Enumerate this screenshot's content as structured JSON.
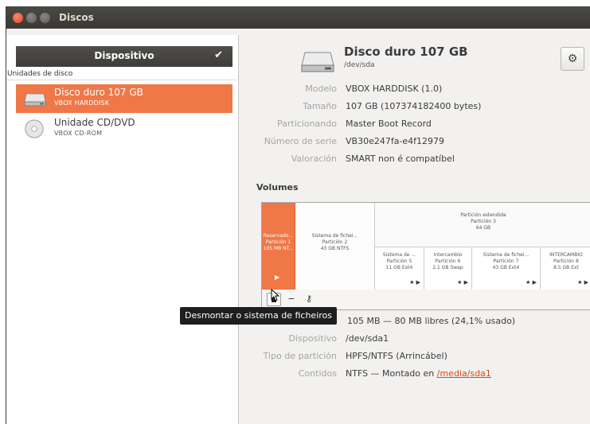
{
  "window": {
    "title": "Discos"
  },
  "sidebar": {
    "header": "Dispositivo",
    "group_label": "Unidades de disco",
    "devices": [
      {
        "name": "Disco duro 107 GB",
        "sub": "VBOX HARDDISK",
        "icon": "hard-disk-icon",
        "selected": true
      },
      {
        "name": "Unidade CD/DVD",
        "sub": "VBOX CD-ROM",
        "icon": "optical-disc-icon",
        "selected": false
      }
    ]
  },
  "disk": {
    "title": "Disco duro 107 GB",
    "path": "/dev/sda",
    "properties": [
      {
        "label": "Modelo",
        "value": "VBOX HARDDISK (1.0)"
      },
      {
        "label": "Tamaño",
        "value": "107 GB (107374182400 bytes)"
      },
      {
        "label": "Particionando",
        "value": "Master Boot Record"
      },
      {
        "label": "Número de serie",
        "value": "VB30e247fa-e4f12979"
      },
      {
        "label": "Valoración",
        "value": "SMART non é compatíbel"
      }
    ]
  },
  "volumes": {
    "heading": "Volumes",
    "partitions": [
      {
        "line1": "Reservado...",
        "line2": "Partición 1",
        "line3": "105 MB NT..."
      },
      {
        "line1": "Sistema de fichei...",
        "line2": "Partición 2",
        "line3": "43 GB NTFS"
      }
    ],
    "extended": {
      "line1": "Partición estendida",
      "line2": "Partición 3",
      "line3": "64 GB"
    },
    "logical": [
      {
        "line1": "Sistema de ...",
        "line2": "Partición 5",
        "line3": "11 GB Ext4"
      },
      {
        "line1": "Intercambio",
        "line2": "Partición 6",
        "line3": "2.1 GB Swap"
      },
      {
        "line1": "Sistema de fichei...",
        "line2": "Partición 7",
        "line3": "43 GB Ext4"
      },
      {
        "line1": "INTERCAMBIO",
        "line2": "Partición 8",
        "line3": "8.5 GB Ext"
      }
    ],
    "toolbar": {
      "minus": "−",
      "key": "⚷"
    },
    "tooltip": "Desmontar o sistema de ficheiros",
    "size_text": "105 MB — 80 MB libres (24,1% usado)",
    "device_label": "Dispositivo",
    "device_value": "/dev/sda1",
    "type_label": "Tipo de partición",
    "type_value": "HPFS/NTFS (Arrincábel)",
    "contents_label": "Contidos",
    "contents_prefix": "NTFS — Montado en ",
    "contents_link": "/media/sda1"
  }
}
